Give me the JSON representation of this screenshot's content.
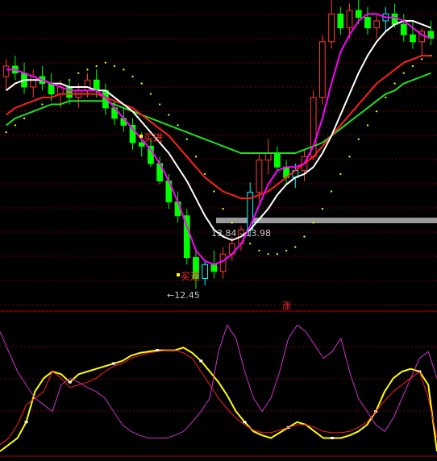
{
  "chart_data": [
    {
      "type": "candlestick",
      "title": "",
      "ylim": [
        12.2,
        16.6
      ],
      "grid": true,
      "price_range_label": "13.84 - 13.98",
      "low_price_label": "12.45",
      "buy_signal_labels": [
        "买进",
        "买进"
      ],
      "colors": {
        "up": "#ff3b3b",
        "down": "#00ff00",
        "up_alt": "#00ffff",
        "ma_fast": "#ff00ff",
        "ma_mid": "#ffffff",
        "ma_slow": "#ff2020",
        "ma_long": "#20e020",
        "sar": "#c8ff00",
        "band": "#a0a0a0"
      },
      "candles": [
        {
          "o": 15.5,
          "h": 15.75,
          "l": 15.3,
          "c": 15.65
        },
        {
          "o": 15.65,
          "h": 15.8,
          "l": 15.45,
          "c": 15.55
        },
        {
          "o": 15.55,
          "h": 15.7,
          "l": 15.25,
          "c": 15.35
        },
        {
          "o": 15.35,
          "h": 15.6,
          "l": 15.2,
          "c": 15.5
        },
        {
          "o": 15.5,
          "h": 15.65,
          "l": 15.3,
          "c": 15.4
        },
        {
          "o": 15.4,
          "h": 15.55,
          "l": 15.15,
          "c": 15.25
        },
        {
          "o": 15.25,
          "h": 15.45,
          "l": 15.05,
          "c": 15.35
        },
        {
          "o": 15.35,
          "h": 15.45,
          "l": 15.1,
          "c": 15.2
        },
        {
          "o": 15.2,
          "h": 15.4,
          "l": 15.05,
          "c": 15.3
        },
        {
          "o": 15.3,
          "h": 15.55,
          "l": 15.2,
          "c": 15.45
        },
        {
          "o": 15.45,
          "h": 15.6,
          "l": 15.2,
          "c": 15.3
        },
        {
          "o": 15.3,
          "h": 15.4,
          "l": 14.95,
          "c": 15.05
        },
        {
          "o": 15.05,
          "h": 15.15,
          "l": 14.8,
          "c": 14.9
        },
        {
          "o": 14.9,
          "h": 15.05,
          "l": 14.7,
          "c": 14.8
        },
        {
          "o": 14.8,
          "h": 14.9,
          "l": 14.45,
          "c": 14.55
        },
        {
          "o": 14.55,
          "h": 14.7,
          "l": 14.35,
          "c": 14.5
        },
        {
          "o": 14.5,
          "h": 14.6,
          "l": 14.2,
          "c": 14.25
        },
        {
          "o": 14.25,
          "h": 14.35,
          "l": 13.95,
          "c": 14.0
        },
        {
          "o": 14.0,
          "h": 14.1,
          "l": 13.6,
          "c": 13.7
        },
        {
          "o": 13.7,
          "h": 13.85,
          "l": 13.4,
          "c": 13.5
        },
        {
          "o": 13.5,
          "h": 13.6,
          "l": 12.8,
          "c": 12.9
        },
        {
          "o": 12.9,
          "h": 13.0,
          "l": 12.45,
          "c": 12.6
        },
        {
          "o": 12.6,
          "h": 12.85,
          "l": 12.5,
          "c": 12.8
        },
        {
          "o": 12.8,
          "h": 13.0,
          "l": 12.6,
          "c": 12.7
        },
        {
          "o": 12.7,
          "h": 13.05,
          "l": 12.6,
          "c": 12.95
        },
        {
          "o": 12.95,
          "h": 13.2,
          "l": 12.85,
          "c": 13.1
        },
        {
          "o": 13.1,
          "h": 13.35,
          "l": 13.0,
          "c": 13.3
        },
        {
          "o": 13.3,
          "h": 13.98,
          "l": 13.2,
          "c": 13.84
        },
        {
          "o": 13.84,
          "h": 14.4,
          "l": 13.7,
          "c": 14.3
        },
        {
          "o": 14.3,
          "h": 14.6,
          "l": 14.1,
          "c": 14.4
        },
        {
          "o": 14.4,
          "h": 14.5,
          "l": 14.15,
          "c": 14.2
        },
        {
          "o": 14.2,
          "h": 14.3,
          "l": 13.95,
          "c": 14.05
        },
        {
          "o": 14.05,
          "h": 14.25,
          "l": 13.9,
          "c": 14.15
        },
        {
          "o": 14.15,
          "h": 14.45,
          "l": 14.0,
          "c": 14.35
        },
        {
          "o": 14.35,
          "h": 15.3,
          "l": 14.3,
          "c": 15.2
        },
        {
          "o": 15.2,
          "h": 16.1,
          "l": 15.1,
          "c": 16.0
        },
        {
          "o": 16.0,
          "h": 16.6,
          "l": 15.9,
          "c": 16.4
        },
        {
          "o": 16.4,
          "h": 16.5,
          "l": 16.1,
          "c": 16.2
        },
        {
          "o": 16.2,
          "h": 16.55,
          "l": 16.05,
          "c": 16.45
        },
        {
          "o": 16.45,
          "h": 16.6,
          "l": 16.25,
          "c": 16.35
        },
        {
          "o": 16.35,
          "h": 16.5,
          "l": 16.1,
          "c": 16.2
        },
        {
          "o": 16.2,
          "h": 16.4,
          "l": 16.05,
          "c": 16.3
        },
        {
          "o": 16.3,
          "h": 16.5,
          "l": 16.15,
          "c": 16.4
        },
        {
          "o": 16.4,
          "h": 16.55,
          "l": 16.2,
          "c": 16.25
        },
        {
          "o": 16.25,
          "h": 16.4,
          "l": 16.0,
          "c": 16.1
        },
        {
          "o": 16.1,
          "h": 16.3,
          "l": 15.9,
          "c": 16.0
        },
        {
          "o": 16.0,
          "h": 16.2,
          "l": 15.8,
          "c": 16.15
        },
        {
          "o": 16.15,
          "h": 16.3,
          "l": 15.95,
          "c": 16.05
        }
      ],
      "ma_fast": [
        15.6,
        15.6,
        15.55,
        15.5,
        15.45,
        15.4,
        15.35,
        15.3,
        15.3,
        15.3,
        15.3,
        15.2,
        15.05,
        14.9,
        14.75,
        14.6,
        14.45,
        14.25,
        14.0,
        13.7,
        13.35,
        13.0,
        12.85,
        12.8,
        12.85,
        12.95,
        13.1,
        13.35,
        13.65,
        13.95,
        14.15,
        14.2,
        14.2,
        14.25,
        14.5,
        14.9,
        15.4,
        15.85,
        16.1,
        16.3,
        16.4,
        16.4,
        16.35,
        16.35,
        16.3,
        16.2,
        16.1,
        16.05
      ],
      "ma_mid": [
        15.3,
        15.4,
        15.45,
        15.45,
        15.45,
        15.4,
        15.4,
        15.35,
        15.35,
        15.35,
        15.3,
        15.3,
        15.2,
        15.1,
        15.0,
        14.85,
        14.7,
        14.55,
        14.4,
        14.2,
        14.0,
        13.75,
        13.5,
        13.3,
        13.2,
        13.15,
        13.2,
        13.3,
        13.45,
        13.6,
        13.8,
        13.95,
        14.05,
        14.1,
        14.2,
        14.4,
        14.65,
        14.95,
        15.25,
        15.55,
        15.8,
        16.0,
        16.15,
        16.25,
        16.3,
        16.3,
        16.25,
        16.2
      ],
      "ma_slow": [
        14.95,
        15.05,
        15.1,
        15.15,
        15.2,
        15.2,
        15.25,
        15.25,
        15.25,
        15.25,
        15.25,
        15.2,
        15.15,
        15.1,
        15.05,
        14.95,
        14.85,
        14.75,
        14.65,
        14.5,
        14.35,
        14.2,
        14.05,
        13.95,
        13.85,
        13.8,
        13.75,
        13.75,
        13.8,
        13.85,
        13.95,
        14.05,
        14.15,
        14.25,
        14.35,
        14.5,
        14.65,
        14.8,
        14.95,
        15.1,
        15.25,
        15.4,
        15.5,
        15.6,
        15.7,
        15.75,
        15.8,
        15.8
      ],
      "ma_long": [
        14.8,
        14.9,
        14.95,
        15.0,
        15.05,
        15.1,
        15.1,
        15.15,
        15.15,
        15.15,
        15.15,
        15.15,
        15.1,
        15.05,
        15.0,
        14.95,
        14.9,
        14.85,
        14.8,
        14.75,
        14.7,
        14.65,
        14.6,
        14.55,
        14.5,
        14.45,
        14.4,
        14.4,
        14.4,
        14.4,
        14.4,
        14.4,
        14.4,
        14.45,
        14.5,
        14.55,
        14.65,
        14.75,
        14.85,
        14.95,
        15.05,
        15.15,
        15.25,
        15.3,
        15.4,
        15.45,
        15.5,
        15.55
      ],
      "sar": [
        14.7,
        14.8,
        14.9,
        15.0,
        15.1,
        15.2,
        15.3,
        15.45,
        15.55,
        15.6,
        15.65,
        15.7,
        15.65,
        15.6,
        15.5,
        15.4,
        15.25,
        15.1,
        14.95,
        14.8,
        14.6,
        14.35,
        14.1,
        13.85,
        13.6,
        13.4,
        13.25,
        13.1,
        13.0,
        12.95,
        12.95,
        13.0,
        13.05,
        13.2,
        13.4,
        13.6,
        13.85,
        14.1,
        14.35,
        14.6,
        14.8,
        15.0,
        15.2,
        15.4,
        15.55,
        15.65,
        15.75,
        15.8
      ]
    },
    {
      "type": "line",
      "title": "涨",
      "ylim": [
        0,
        100
      ],
      "grid": true,
      "series": [
        {
          "values": [
            0,
            5,
            10,
            22,
            45,
            55,
            60,
            58,
            52,
            58,
            60,
            62,
            64,
            66,
            68,
            72,
            74,
            75,
            76,
            76,
            76,
            78,
            74,
            68,
            60,
            52,
            42,
            30,
            22,
            15,
            12,
            10,
            14,
            18,
            22,
            20,
            15,
            10,
            10,
            10,
            12,
            15,
            20,
            30,
            45,
            55,
            60,
            62,
            60,
            50,
            0
          ]
        },
        {
          "values": [
            5,
            10,
            20,
            35,
            40,
            45,
            60,
            55,
            48,
            50,
            52,
            55,
            60,
            64,
            66,
            70,
            72,
            74,
            75,
            76,
            76,
            74,
            70,
            60,
            50,
            40,
            32,
            25,
            20,
            16,
            14,
            14,
            16,
            18,
            20,
            20,
            18,
            15,
            14,
            14,
            15,
            18,
            22,
            30,
            38,
            45,
            50,
            55,
            60,
            40,
            10
          ]
        },
        {
          "values": [
            90,
            75,
            60,
            50,
            40,
            35,
            30,
            50,
            55,
            52,
            48,
            45,
            40,
            30,
            20,
            15,
            12,
            10,
            10,
            10,
            12,
            15,
            22,
            30,
            40,
            75,
            95,
            85,
            60,
            40,
            30,
            40,
            60,
            85,
            95,
            90,
            80,
            70,
            75,
            85,
            60,
            40,
            30,
            20,
            15,
            25,
            40,
            55,
            70,
            75,
            55
          ]
        }
      ]
    }
  ]
}
